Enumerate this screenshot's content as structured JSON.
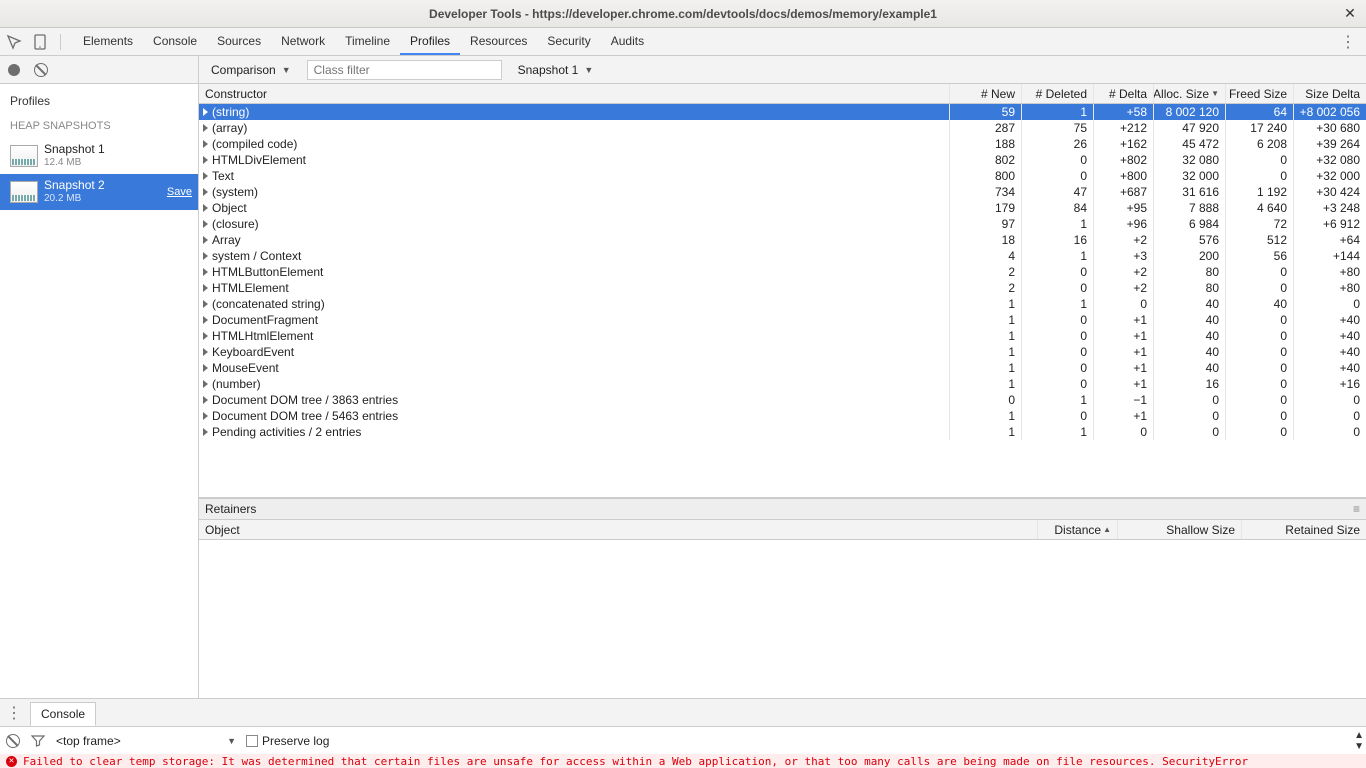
{
  "window": {
    "title": "Developer Tools - https://developer.chrome.com/devtools/docs/demos/memory/example1"
  },
  "tabs": [
    "Elements",
    "Console",
    "Sources",
    "Network",
    "Timeline",
    "Profiles",
    "Resources",
    "Security",
    "Audits"
  ],
  "active_tab": "Profiles",
  "sidebar": {
    "title": "Profiles",
    "category": "HEAP SNAPSHOTS",
    "snapshots": [
      {
        "name": "Snapshot 1",
        "size": "12.4 MB",
        "selected": false
      },
      {
        "name": "Snapshot 2",
        "size": "20.2 MB",
        "selected": true,
        "save": "Save"
      }
    ]
  },
  "filterbar": {
    "view": "Comparison",
    "class_placeholder": "Class filter",
    "base": "Snapshot 1"
  },
  "columns": [
    "Constructor",
    "# New",
    "# Deleted",
    "# Delta",
    "Alloc. Size",
    "Freed Size",
    "Size Delta"
  ],
  "sort_col": "Alloc. Size",
  "rows": [
    {
      "c": "(string)",
      "n": "59",
      "d": "1",
      "dl": "+58",
      "a": "8 002 120",
      "f": "64",
      "sd": "+8 002 056",
      "sel": true
    },
    {
      "c": "(array)",
      "n": "287",
      "d": "75",
      "dl": "+212",
      "a": "47 920",
      "f": "17 240",
      "sd": "+30 680"
    },
    {
      "c": "(compiled code)",
      "n": "188",
      "d": "26",
      "dl": "+162",
      "a": "45 472",
      "f": "6 208",
      "sd": "+39 264"
    },
    {
      "c": "HTMLDivElement",
      "n": "802",
      "d": "0",
      "dl": "+802",
      "a": "32 080",
      "f": "0",
      "sd": "+32 080"
    },
    {
      "c": "Text",
      "n": "800",
      "d": "0",
      "dl": "+800",
      "a": "32 000",
      "f": "0",
      "sd": "+32 000"
    },
    {
      "c": "(system)",
      "n": "734",
      "d": "47",
      "dl": "+687",
      "a": "31 616",
      "f": "1 192",
      "sd": "+30 424"
    },
    {
      "c": "Object",
      "n": "179",
      "d": "84",
      "dl": "+95",
      "a": "7 888",
      "f": "4 640",
      "sd": "+3 248"
    },
    {
      "c": "(closure)",
      "n": "97",
      "d": "1",
      "dl": "+96",
      "a": "6 984",
      "f": "72",
      "sd": "+6 912"
    },
    {
      "c": "Array",
      "n": "18",
      "d": "16",
      "dl": "+2",
      "a": "576",
      "f": "512",
      "sd": "+64"
    },
    {
      "c": "system / Context",
      "n": "4",
      "d": "1",
      "dl": "+3",
      "a": "200",
      "f": "56",
      "sd": "+144"
    },
    {
      "c": "HTMLButtonElement",
      "n": "2",
      "d": "0",
      "dl": "+2",
      "a": "80",
      "f": "0",
      "sd": "+80"
    },
    {
      "c": "HTMLElement",
      "n": "2",
      "d": "0",
      "dl": "+2",
      "a": "80",
      "f": "0",
      "sd": "+80"
    },
    {
      "c": "(concatenated string)",
      "n": "1",
      "d": "1",
      "dl": "0",
      "a": "40",
      "f": "40",
      "sd": "0"
    },
    {
      "c": "DocumentFragment",
      "n": "1",
      "d": "0",
      "dl": "+1",
      "a": "40",
      "f": "0",
      "sd": "+40"
    },
    {
      "c": "HTMLHtmlElement",
      "n": "1",
      "d": "0",
      "dl": "+1",
      "a": "40",
      "f": "0",
      "sd": "+40"
    },
    {
      "c": "KeyboardEvent",
      "n": "1",
      "d": "0",
      "dl": "+1",
      "a": "40",
      "f": "0",
      "sd": "+40"
    },
    {
      "c": "MouseEvent",
      "n": "1",
      "d": "0",
      "dl": "+1",
      "a": "40",
      "f": "0",
      "sd": "+40"
    },
    {
      "c": "(number)",
      "n": "1",
      "d": "0",
      "dl": "+1",
      "a": "16",
      "f": "0",
      "sd": "+16"
    },
    {
      "c": "Document DOM tree / 3863 entries",
      "n": "0",
      "d": "1",
      "dl": "−1",
      "a": "0",
      "f": "0",
      "sd": "0"
    },
    {
      "c": "Document DOM tree / 5463 entries",
      "n": "1",
      "d": "0",
      "dl": "+1",
      "a": "0",
      "f": "0",
      "sd": "0"
    },
    {
      "c": "Pending activities / 2 entries",
      "n": "1",
      "d": "1",
      "dl": "0",
      "a": "0",
      "f": "0",
      "sd": "0"
    }
  ],
  "retainers": {
    "title": "Retainers",
    "columns": [
      "Object",
      "Distance",
      "Shallow Size",
      "Retained Size"
    ]
  },
  "drawer": {
    "console": "Console"
  },
  "console": {
    "frame": "<top frame>",
    "preserve": "Preserve log",
    "error": "Failed to clear temp storage: It was determined that certain files are unsafe for access within a Web application, or that too many calls are being made on file resources. SecurityError"
  }
}
